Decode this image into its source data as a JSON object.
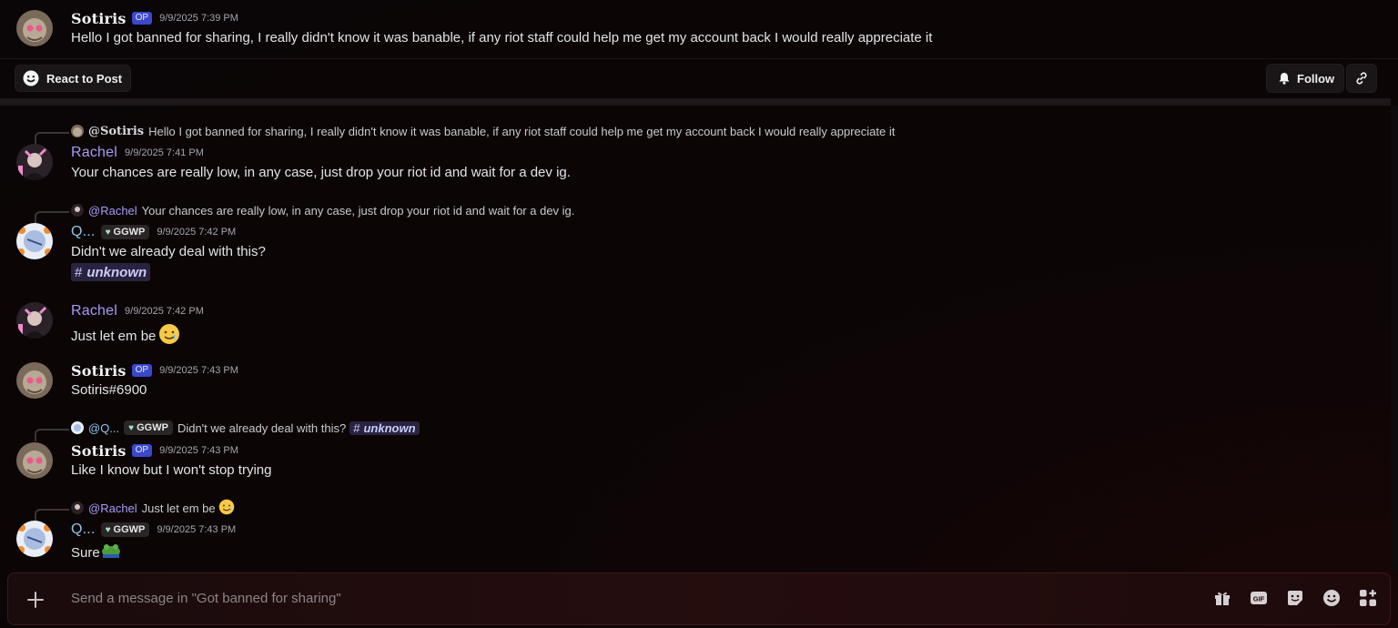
{
  "op_post": {
    "author": "Sotiris",
    "badge": "OP",
    "time": "9/9/2025 7:39 PM",
    "text": "Hello I got banned for sharing, I really didn't know it was banable, if any riot staff could help me get my account back I would really appreciate it"
  },
  "toolbar": {
    "react_label": "React to Post",
    "follow_label": "Follow"
  },
  "messages": [
    {
      "reply": {
        "mention": "@Sotiris",
        "text": "Hello I got banned for sharing, I really didn't know it was banable, if any riot staff could help me get my account back I would really appreciate it"
      },
      "author": "Rachel",
      "time": "9/9/2025 7:41 PM",
      "text": "Your chances are really low, in any case, just drop your riot id and wait for a dev ig."
    },
    {
      "reply": {
        "mention": "@Rachel",
        "text": "Your chances are really low, in any case, just drop your riot id and wait for a dev ig."
      },
      "author": "Q...",
      "tag": "GGWP",
      "time": "9/9/2025 7:42 PM",
      "text": "Didn't we already deal with this?",
      "channel": "unknown"
    },
    {
      "author": "Rachel",
      "time": "9/9/2025 7:42 PM",
      "text": "Just let em be"
    },
    {
      "author": "Sotiris",
      "badge": "OP",
      "time": "9/9/2025 7:43 PM",
      "text": "Sotiris#6900"
    },
    {
      "reply": {
        "mention": "@Q...",
        "tag": "GGWP",
        "text": "Didn't we already deal with this?",
        "channel": "unknown"
      },
      "author": "Sotiris",
      "badge": "OP",
      "time": "9/9/2025 7:43 PM",
      "text": "Like I know but I won't stop trying"
    },
    {
      "reply": {
        "mention": "@Rachel",
        "text": "Just let em be"
      },
      "author": "Q...",
      "tag": "GGWP",
      "time": "9/9/2025 7:43 PM",
      "text": "Sure"
    }
  ],
  "composer": {
    "placeholder": "Send a message in \"Got banned for sharing\""
  },
  "colors": {
    "op_badge": "#3b48c8",
    "rachel_name": "#a79cf5",
    "q_name": "#8ec5e8",
    "channel_pill_bg": "#2a2340"
  },
  "icons": {
    "composer": [
      "gift-icon",
      "gif-icon",
      "sticker-icon",
      "emoji-icon",
      "apps-icon"
    ]
  }
}
